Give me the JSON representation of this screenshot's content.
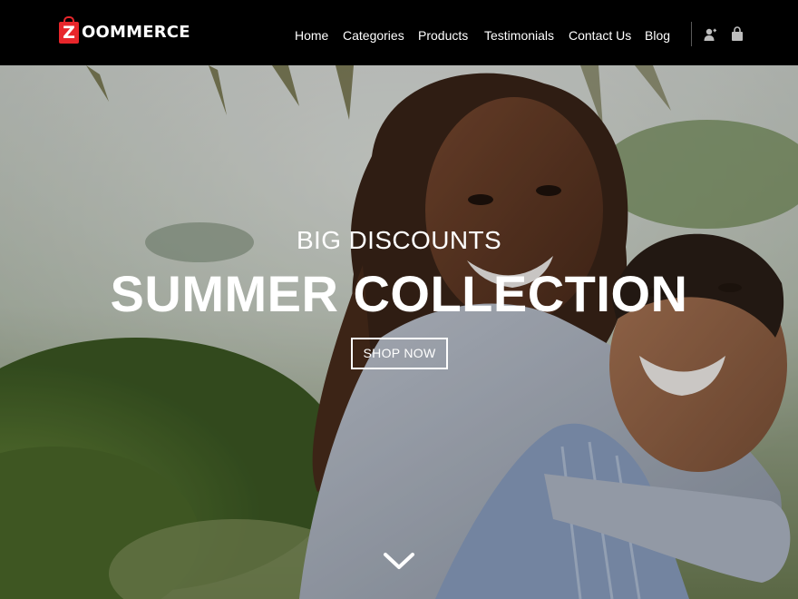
{
  "brand": {
    "badge_letter": "Z",
    "name": "OOMMERCE",
    "accent_color": "#e8262b"
  },
  "nav": {
    "items": [
      "Home",
      "Categories",
      "Products",
      "Testimonials",
      "Contact Us",
      "Blog"
    ]
  },
  "header_icons": [
    "user-icon",
    "shopping-bag-icon"
  ],
  "hero": {
    "kicker": "BIG DISCOUNTS",
    "title": "SUMMER COLLECTION",
    "cta": "SHOP NOW",
    "scroll_icon": "chevron-down-icon",
    "photo": "smiling couple hugging outdoors"
  }
}
